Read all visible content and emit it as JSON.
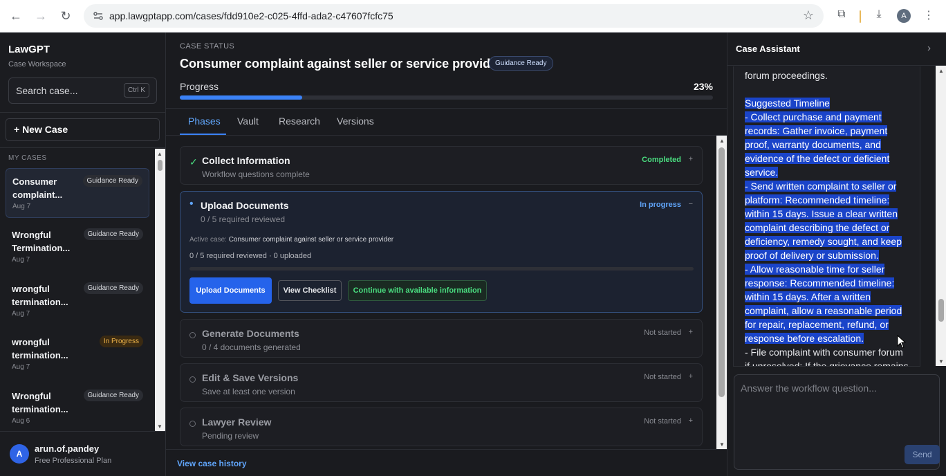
{
  "browser": {
    "url": "app.lawgptapp.com/cases/fdd910e2-c025-4ffd-ada2-c47607fcfc75",
    "profile_initial": "A"
  },
  "sidebar": {
    "brand": "LawGPT",
    "subtitle": "Case Workspace",
    "search_placeholder": "Search case...",
    "search_shortcut": "Ctrl K",
    "new_case": "+ New Case",
    "section_label": "MY CASES",
    "cases": [
      {
        "title": "Consumer complaint...",
        "date": "Aug 7",
        "badge": "Guidance Ready"
      },
      {
        "title": "Wrongful Termination...",
        "date": "Aug 7",
        "badge": "Guidance Ready"
      },
      {
        "title": "wrongful termination...",
        "date": "Aug 7",
        "badge": "Guidance Ready"
      },
      {
        "title": "wrongful termination...",
        "date": "Aug 7",
        "badge": "In Progress"
      },
      {
        "title": "Wrongful termination...",
        "date": "Aug 6",
        "badge": "Guidance Ready"
      }
    ],
    "user": {
      "initial": "A",
      "name": "arun.of.pandey",
      "plan": "Free Professional Plan"
    }
  },
  "main": {
    "status_label": "CASE STATUS",
    "title": "Consumer complaint against seller or service provider",
    "badge": "Guidance Ready",
    "progress_label": "Progress",
    "progress_text": "23%",
    "progress_value": 0.23,
    "tabs": [
      "Phases",
      "Vault",
      "Research",
      "Versions"
    ],
    "phases": [
      {
        "name": "Collect Information",
        "sub": "Workflow questions complete",
        "status": "Completed",
        "toggle": "+",
        "icon": "✓"
      },
      {
        "name": "Upload Documents",
        "sub": "0 / 5 required reviewed",
        "status": "In progress",
        "toggle": "−",
        "icon": "•"
      },
      {
        "name": "Generate Documents",
        "sub": "0 / 4 documents generated",
        "status": "Not started",
        "toggle": "+"
      },
      {
        "name": "Edit & Save Versions",
        "sub": "Save at least one version",
        "status": "Not started",
        "toggle": "+"
      },
      {
        "name": "Lawyer Review",
        "sub": "Pending review",
        "status": "Not started",
        "toggle": "+"
      }
    ],
    "active_case_label": "Active case:",
    "active_case_value": "Consumer complaint against seller or service provider",
    "upload_stats": "0 / 5 required reviewed · 0 uploaded",
    "buttons": {
      "upload": "Upload Documents",
      "checklist": "View Checklist",
      "continue": "Continue with available information"
    },
    "history_link": "View case history"
  },
  "assistant": {
    "title": "Case Assistant",
    "close_glyph": "›",
    "lines_plain_top": [
      "forum proceedings."
    ],
    "lines_selected": [
      "Suggested Timeline",
      "- Collect purchase and payment",
      "records: Gather invoice, payment",
      "proof, warranty documents, and",
      "evidence of the defect or deficient",
      "service.",
      "- Send written complaint to seller or",
      "platform: Recommended timeline:",
      "within 15 days. Issue a clear written",
      "complaint describing the defect or",
      "deficiency, remedy sought, and keep",
      "proof of delivery or submission.",
      "- Allow reasonable time for seller",
      "response: Recommended timeline:",
      "within 15 days. After a written",
      "complaint, allow a reasonable period",
      "for repair, replacement, refund, or",
      "response before escalation."
    ],
    "lines_plain_bottom": [
      "- File complaint with consumer forum",
      "if unresolved: If the grievance remains"
    ],
    "input_placeholder": "Answer the workflow question...",
    "send": "Send"
  },
  "colors": {
    "accent": "#3b82f6",
    "success": "#4ade80",
    "warning": "#f0b54a",
    "selection": "#1a44c9"
  }
}
